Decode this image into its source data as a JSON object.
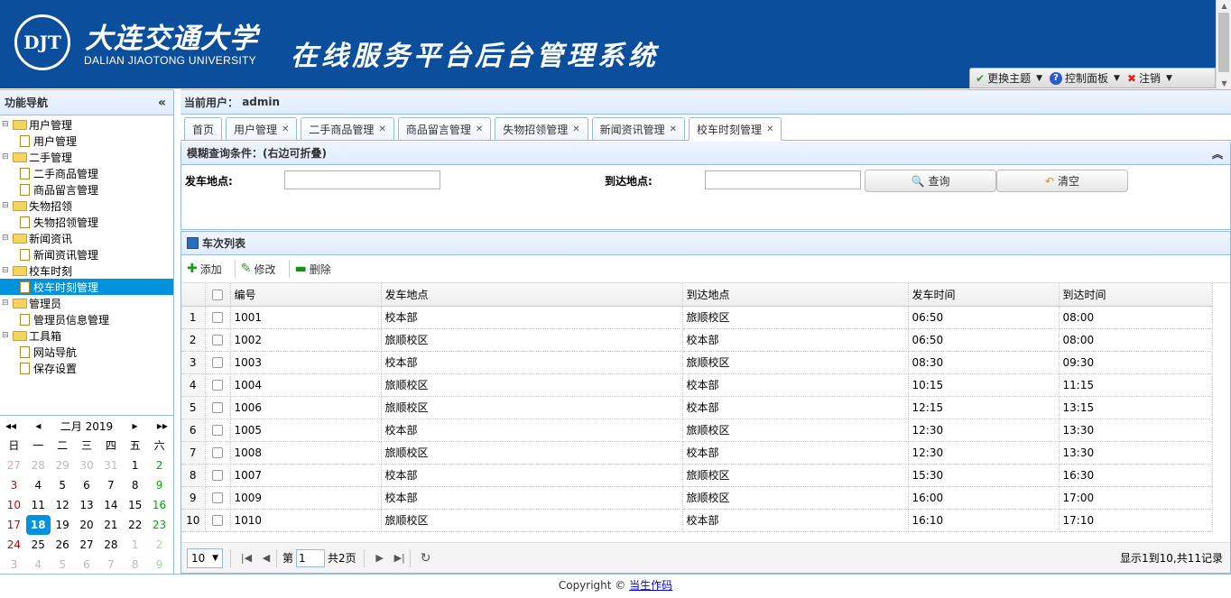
{
  "header": {
    "logo_text": "DJT",
    "university_cn": "大连交通大学",
    "university_en": "DALIAN JIAOTONG UNIVERSITY",
    "system_title": "在线服务平台后台管理系统",
    "toolbar": {
      "theme_label": "更换主题",
      "control_label": "控制面板",
      "logout_label": "注销"
    }
  },
  "sidebar": {
    "title": "功能导航",
    "tree": [
      {
        "label": "用户管理",
        "children": [
          "用户管理"
        ]
      },
      {
        "label": "二手管理",
        "children": [
          "二手商品管理",
          "商品留言管理"
        ]
      },
      {
        "label": "失物招领",
        "children": [
          "失物招领管理"
        ]
      },
      {
        "label": "新闻资讯",
        "children": [
          "新闻资讯管理"
        ]
      },
      {
        "label": "校车时刻",
        "children": [
          "校车时刻管理"
        ]
      },
      {
        "label": "管理员",
        "children": [
          "管理员信息管理"
        ]
      },
      {
        "label": "工具箱",
        "children": [
          "网站导航",
          "保存设置"
        ]
      }
    ],
    "selected": "校车时刻管理"
  },
  "calendar": {
    "month_label": "二月 2019",
    "weekdays": [
      "日",
      "一",
      "二",
      "三",
      "四",
      "五",
      "六"
    ],
    "days": [
      "27",
      "28",
      "29",
      "30",
      "31",
      "1",
      "2",
      "3",
      "4",
      "5",
      "6",
      "7",
      "8",
      "9",
      "10",
      "11",
      "12",
      "13",
      "14",
      "15",
      "16",
      "17",
      "18",
      "19",
      "20",
      "21",
      "22",
      "23",
      "24",
      "25",
      "26",
      "27",
      "28",
      "1",
      "2",
      "3",
      "4",
      "5",
      "6",
      "7",
      "8",
      "9"
    ],
    "today": "18"
  },
  "main": {
    "current_user_label": "当前用户：",
    "current_user": "admin",
    "tabs": [
      {
        "label": "首页",
        "closable": false
      },
      {
        "label": "用户管理",
        "closable": true
      },
      {
        "label": "二手商品管理",
        "closable": true
      },
      {
        "label": "商品留言管理",
        "closable": true
      },
      {
        "label": "失物招领管理",
        "closable": true
      },
      {
        "label": "新闻资讯管理",
        "closable": true
      },
      {
        "label": "校车时刻管理",
        "closable": true,
        "active": true
      }
    ],
    "search": {
      "title": "模糊查询条件：(右边可折叠)",
      "depart_label": "发车地点:",
      "arrive_label": "到达地点:",
      "depart_value": "",
      "arrive_value": "",
      "query_label": "查询",
      "clear_label": "清空"
    },
    "grid": {
      "title": "车次列表",
      "add_label": "添加",
      "edit_label": "修改",
      "delete_label": "删除",
      "columns": [
        "编号",
        "发车地点",
        "到达地点",
        "发车时间",
        "到达时间"
      ],
      "rows": [
        [
          "1001",
          "校本部",
          "旅顺校区",
          "06:50",
          "08:00"
        ],
        [
          "1002",
          "旅顺校区",
          "校本部",
          "06:50",
          "08:00"
        ],
        [
          "1003",
          "校本部",
          "旅顺校区",
          "08:30",
          "09:30"
        ],
        [
          "1004",
          "旅顺校区",
          "校本部",
          "10:15",
          "11:15"
        ],
        [
          "1006",
          "旅顺校区",
          "校本部",
          "12:15",
          "13:15"
        ],
        [
          "1005",
          "校本部",
          "旅顺校区",
          "12:30",
          "13:30"
        ],
        [
          "1008",
          "旅顺校区",
          "校本部",
          "12:30",
          "13:30"
        ],
        [
          "1007",
          "校本部",
          "旅顺校区",
          "15:30",
          "16:30"
        ],
        [
          "1009",
          "校本部",
          "旅顺校区",
          "16:00",
          "17:00"
        ],
        [
          "1010",
          "旅顺校区",
          "校本部",
          "16:10",
          "17:10"
        ]
      ]
    },
    "pager": {
      "page_size": "10",
      "page_prefix": "第",
      "page_number": "1",
      "page_total": "共2页",
      "info": "显示1到10,共11记录"
    }
  },
  "footer": {
    "copyright": "Copyright ©",
    "author_link": "当生作码"
  },
  "colors": {
    "header_bg": "#0b4f9c",
    "panel_border": "#95b8e7",
    "selection": "#0092dc"
  }
}
